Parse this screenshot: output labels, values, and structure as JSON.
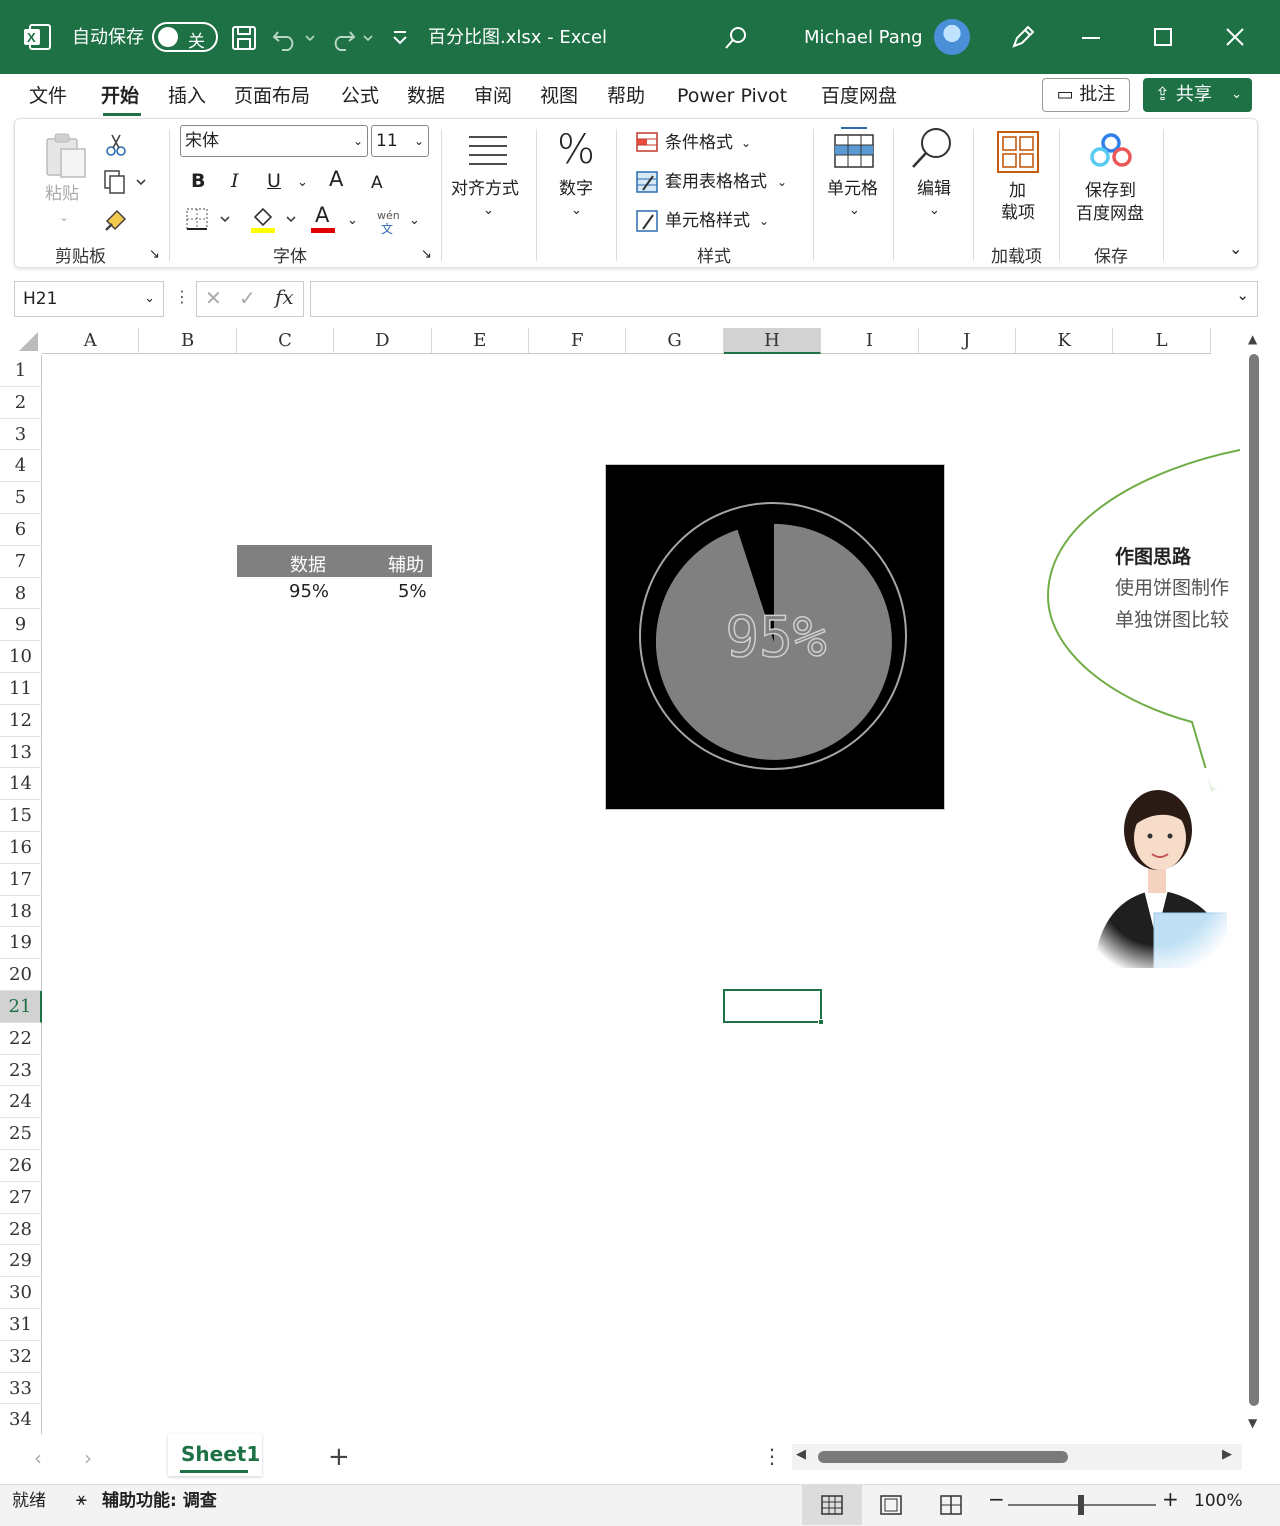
{
  "titlebar": {
    "autosave_label": "自动保存",
    "autosave_state": "关",
    "file_title": "百分比图.xlsx  -  Excel",
    "user_name": "Michael Pang",
    "colors": {
      "bg": "#1e7145"
    }
  },
  "menu": {
    "tabs": [
      "文件",
      "开始",
      "插入",
      "页面布局",
      "公式",
      "数据",
      "审阅",
      "视图",
      "帮助",
      "Power Pivot",
      "百度网盘"
    ],
    "active_tab": "开始",
    "comment_label": "批注",
    "share_label": "共享"
  },
  "ribbon": {
    "clipboard": {
      "paste_label": "粘贴",
      "group_label": "剪贴板"
    },
    "font": {
      "font_name": "宋体",
      "font_size": "11",
      "group_label": "字体",
      "bold": "B",
      "italic": "I",
      "underline": "U",
      "grow": "A",
      "shrink": "A",
      "font_color": "A",
      "phonetic_top": "wén",
      "phonetic_bottom": "文"
    },
    "alignment": {
      "label": "对齐方式"
    },
    "number": {
      "label": "数字",
      "icon": "%"
    },
    "styles": {
      "conditional": "条件格式",
      "table_format": "套用表格格式",
      "cell_styles": "单元格样式",
      "group_label": "样式"
    },
    "cells": {
      "label": "单元格"
    },
    "editing": {
      "label": "编辑"
    },
    "addins": {
      "label_line1": "加",
      "label_line2": "载项",
      "group_label": "加载项"
    },
    "save": {
      "label_line1": "保存到",
      "label_line2": "百度网盘",
      "group_label": "保存"
    }
  },
  "formula_bar": {
    "name_box": "H21",
    "fx": "fx",
    "formula": ""
  },
  "grid": {
    "columns": [
      "A",
      "B",
      "C",
      "D",
      "E",
      "F",
      "G",
      "H",
      "I",
      "J",
      "K",
      "L"
    ],
    "selected_column": "H",
    "rows": [
      "1",
      "2",
      "3",
      "4",
      "5",
      "6",
      "7",
      "8",
      "9",
      "10",
      "11",
      "12",
      "13",
      "14",
      "15",
      "16",
      "17",
      "18",
      "19",
      "20",
      "21",
      "22",
      "23",
      "24",
      "25",
      "26",
      "27",
      "28",
      "29",
      "30",
      "31",
      "32",
      "33",
      "34"
    ],
    "selected_row": "21",
    "table": {
      "header_data": "数据",
      "header_aux": "辅助",
      "value_data": "95%",
      "value_aux": "5%"
    }
  },
  "chart_data": {
    "type": "pie",
    "categories": [
      "数据",
      "辅助"
    ],
    "values": [
      95,
      5
    ],
    "center_label": "95%",
    "colors": {
      "background": "#000000",
      "data": "#808080",
      "aux": "#000000",
      "ring": "#a6a6a6"
    }
  },
  "callout": {
    "title": "作图思路",
    "line1": "使用饼图制作",
    "line2": "单独饼图比较"
  },
  "sheets": {
    "tabs": [
      "Sheet1"
    ],
    "active": "Sheet1",
    "add": "+"
  },
  "status": {
    "ready": "就绪",
    "accessibility": "辅助功能: 调查",
    "zoom": "100%"
  }
}
